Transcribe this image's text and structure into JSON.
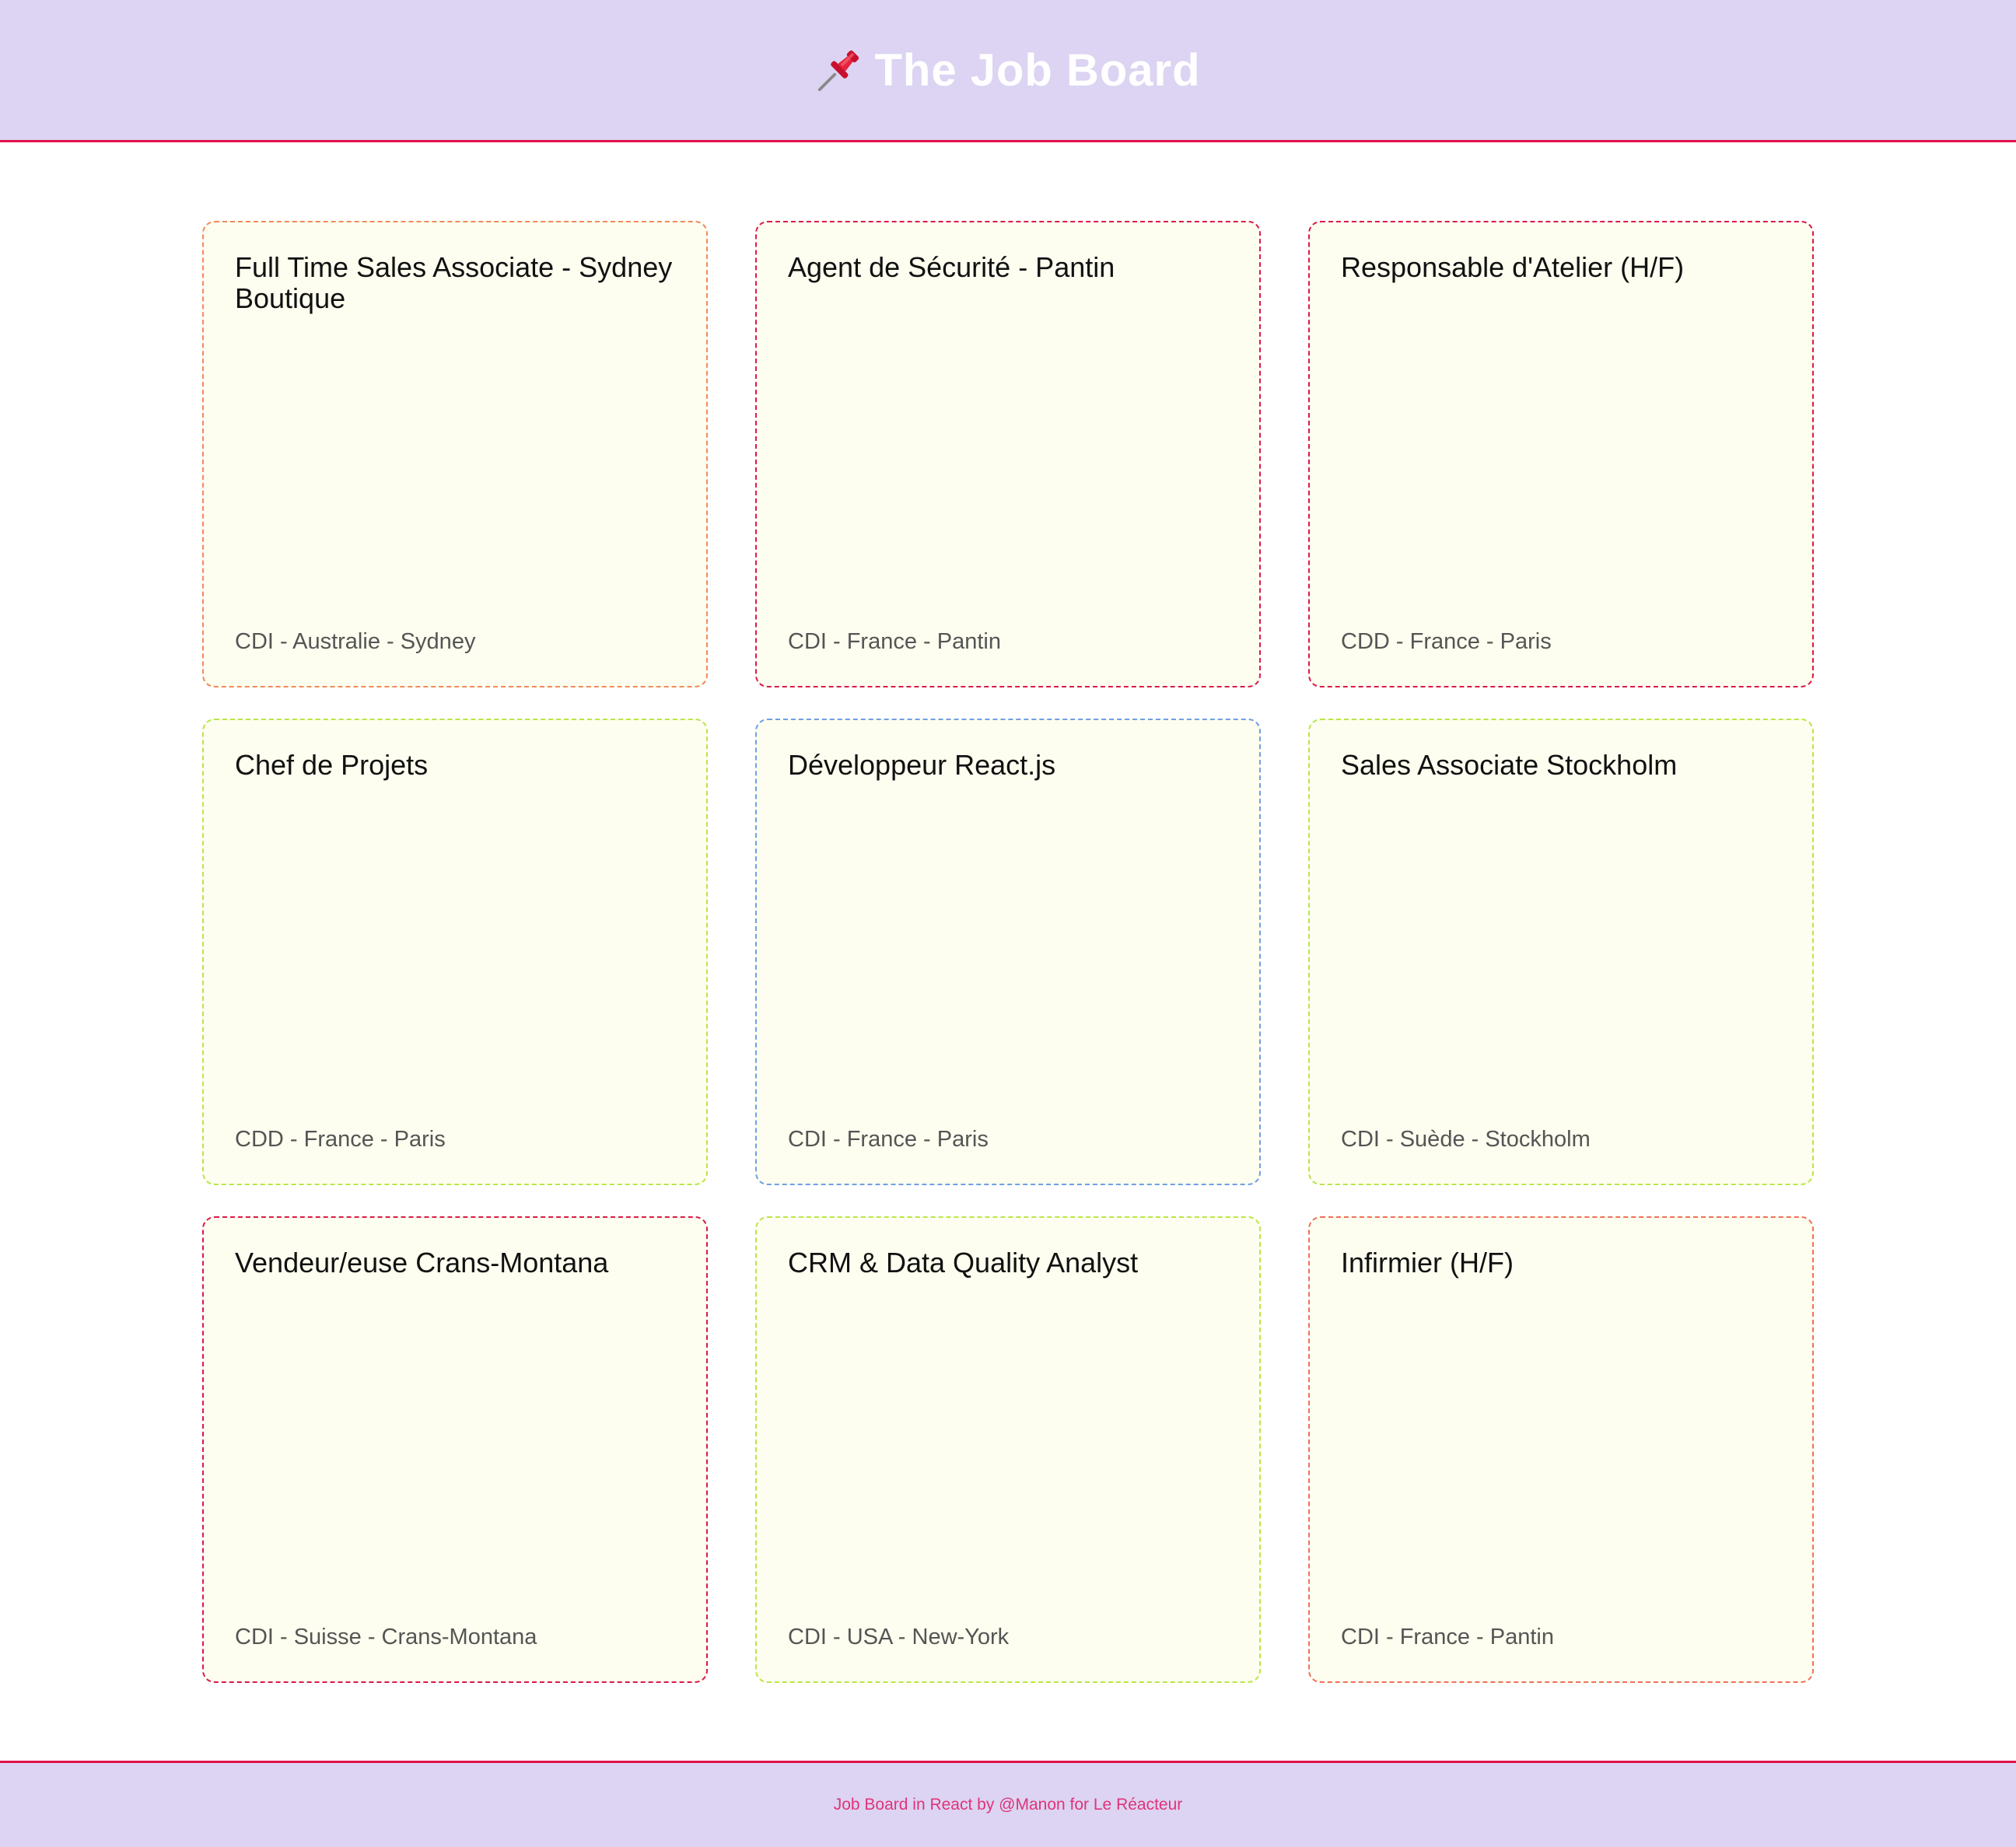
{
  "header": {
    "icon": "pushpin-icon",
    "title": "The Job Board",
    "bg_color": "#dcd4f2",
    "accent_color": "#e0144b"
  },
  "jobs": [
    {
      "title": "Full Time Sales Associate - Sydney Boutique",
      "meta": "CDI - Australie - Sydney",
      "border_color": "#f28a5b"
    },
    {
      "title": "Agent de Sécurité - Pantin",
      "meta": "CDI - France - Pantin",
      "border_color": "#d91a4d"
    },
    {
      "title": "Responsable d'Atelier (H/F)",
      "meta": "CDD - France - Paris",
      "border_color": "#d91a4d"
    },
    {
      "title": "Chef de Projets",
      "meta": "CDD - France - Paris",
      "border_color": "#b9e64a"
    },
    {
      "title": "Développeur React.js",
      "meta": "CDI - France - Paris",
      "border_color": "#6f9fe6"
    },
    {
      "title": "Sales Associate Stockholm",
      "meta": "CDI - Suède - Stockholm",
      "border_color": "#b9e64a"
    },
    {
      "title": "Vendeur/euse Crans-Montana",
      "meta": "CDI - Suisse - Crans-Montana",
      "border_color": "#d91a4d"
    },
    {
      "title": "CRM & Data Quality Analyst",
      "meta": "CDI - USA - New-York",
      "border_color": "#b9e64a"
    },
    {
      "title": "Infirmier (H/F)",
      "meta": "CDI - France - Pantin",
      "border_color": "#f0705a"
    }
  ],
  "card_bg": "#fdfeef",
  "footer": {
    "text": "Job Board in React by @Manon for Le Réacteur",
    "text_color": "#e0347a"
  }
}
